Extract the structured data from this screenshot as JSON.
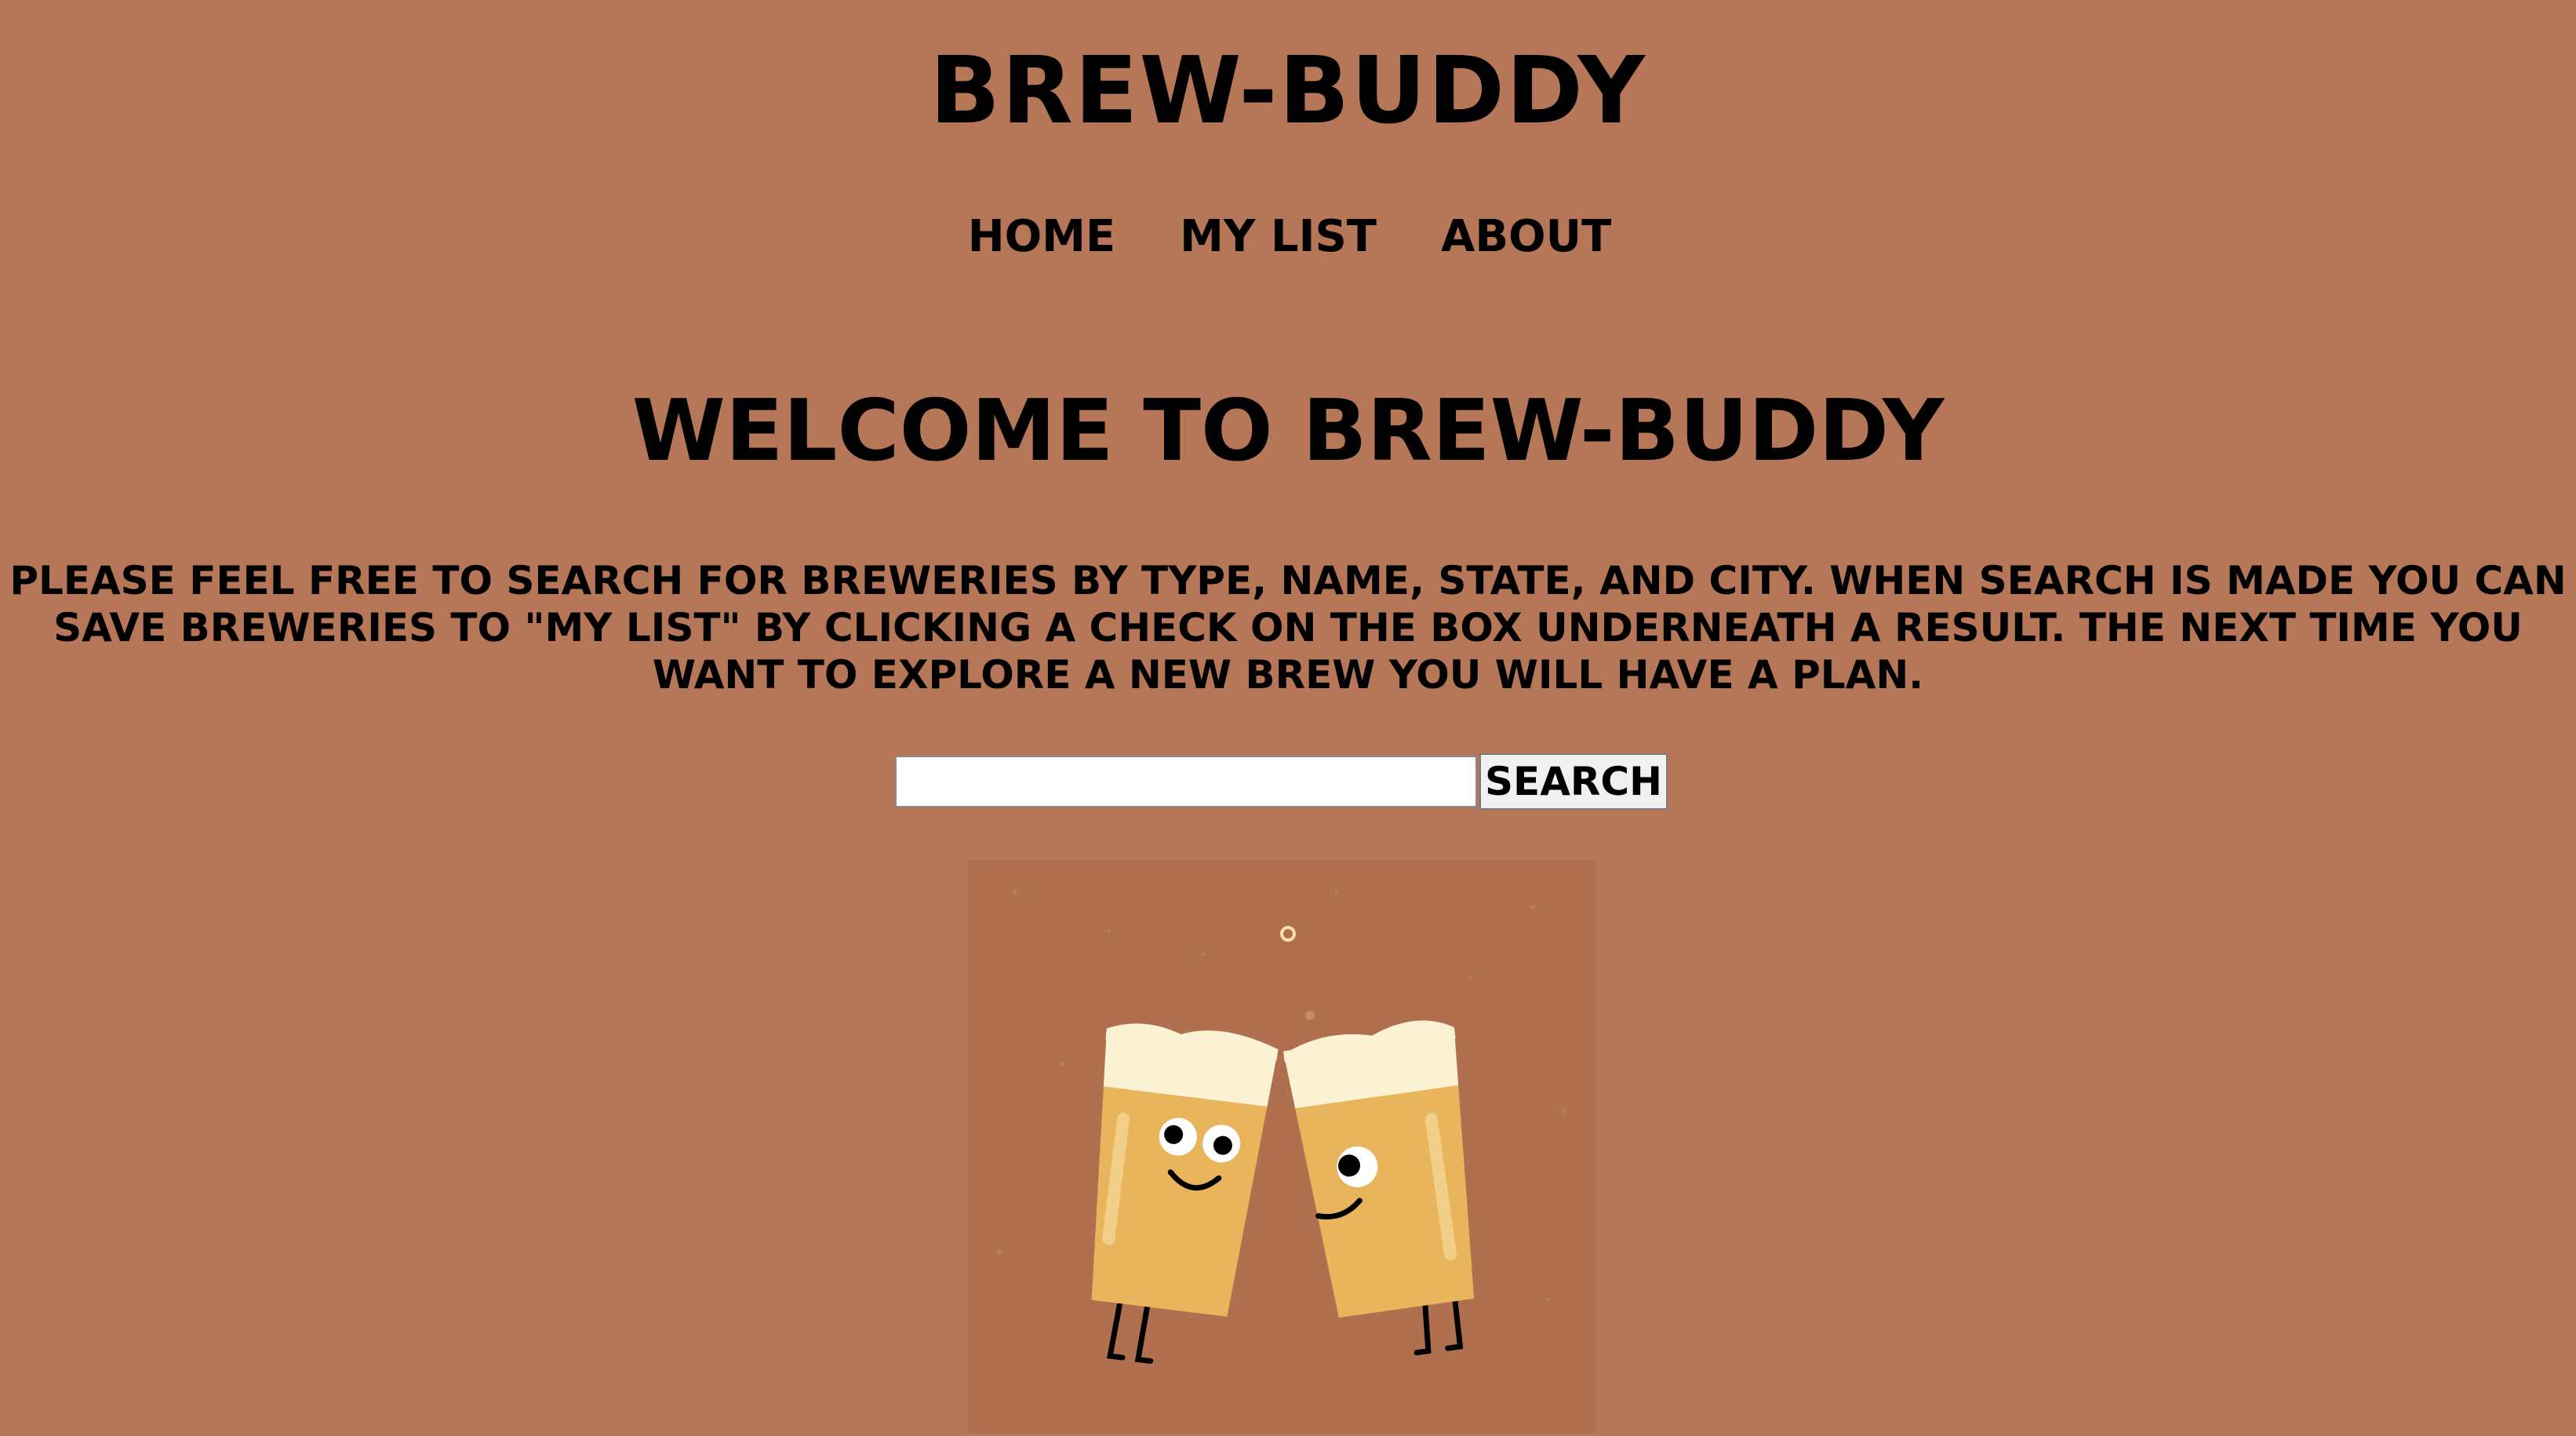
{
  "header": {
    "site_title": "Brew-Buddy"
  },
  "nav": {
    "items": [
      {
        "label": "Home"
      },
      {
        "label": "My List"
      },
      {
        "label": "About"
      }
    ]
  },
  "main": {
    "heading": "Welcome to Brew-Buddy",
    "intro": "Please feel free to search for breweries by type, name, state, and city. When search is made you can save breweries to \"My List\" by clicking a check on the box underneath a result. The next time you want to explore a new brew you will have a plan.",
    "search": {
      "value": "",
      "placeholder": "",
      "button_label": "Search"
    },
    "illustration": {
      "icon": "cheering-beer-mugs-illustration",
      "background_color": "#b67658",
      "panel_color": "#b0704f",
      "beer_color": "#e8b45c",
      "foam_color": "#fbf2d4"
    }
  }
}
